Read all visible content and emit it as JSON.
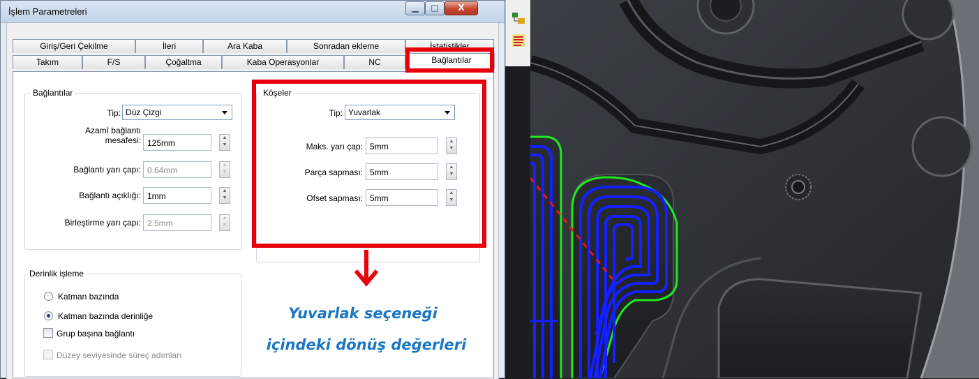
{
  "window": {
    "title": "İşlem Parametreleri",
    "min_glyph": "▁",
    "max_glyph": "□",
    "close_glyph": "X"
  },
  "tabs": {
    "back_row": [
      "Giriş/Geri Çekilme",
      "İleri",
      "Ara Kaba",
      "Sonradan ekleme",
      "İstatistikler"
    ],
    "front_row": [
      "Takım",
      "F/S",
      "Çoğaltma",
      "Kaba Operasyonlar",
      "NC",
      "Bağlantılar"
    ],
    "active": "Bağlantılar"
  },
  "links_group": {
    "title": "Bağlantılar",
    "type_label": "Tip:",
    "type_value": "Düz Çizgi",
    "max_link_label_1": "Azamî bağlantı",
    "max_link_label_2": "mesafesi:",
    "max_link_value": "125mm",
    "link_radius_label": "Bağlantı yarı çapı:",
    "link_radius_value": "0.64mm",
    "link_clearance_label": "Bağlantı açıklığı:",
    "link_clearance_value": "1mm",
    "merge_radius_label": "Birleştirme yarı çapı:",
    "merge_radius_value": "2.5mm"
  },
  "corners_group": {
    "title": "Köşeler",
    "type_label": "Tip:",
    "type_value": "Yuvarlak",
    "max_radius_label": "Maks. yarı çap:",
    "max_radius_value": "5mm",
    "part_dev_label": "Parça sapması:",
    "part_dev_value": "5mm",
    "offset_dev_label": "Ofset sapması:",
    "offset_dev_value": "5mm"
  },
  "depth_group": {
    "title": "Derinlik işleme",
    "option_layer": "Katman bazında",
    "option_layer_depth": "Katman bazında derinliğe",
    "selected": "Katman bazında derinliğe",
    "link_per_group": "Grup başına bağlantı",
    "link_per_group_checked": false,
    "level_steps": "Düzey seviyesinde süreç adımları",
    "level_steps_checked": false
  },
  "annotation": {
    "line1": "Yuvarlak seçeneği",
    "line2": "içindeki dönüş değerleri",
    "highlight_color": "#e8000b",
    "text_color": "#1a76c4"
  },
  "toolbar_icons": [
    "part-tree-icon",
    "toolpath-icon"
  ],
  "viewport": {
    "toolpath_color": "#1420ff",
    "boundary_color": "#22e622",
    "link_color": "#e01818"
  }
}
